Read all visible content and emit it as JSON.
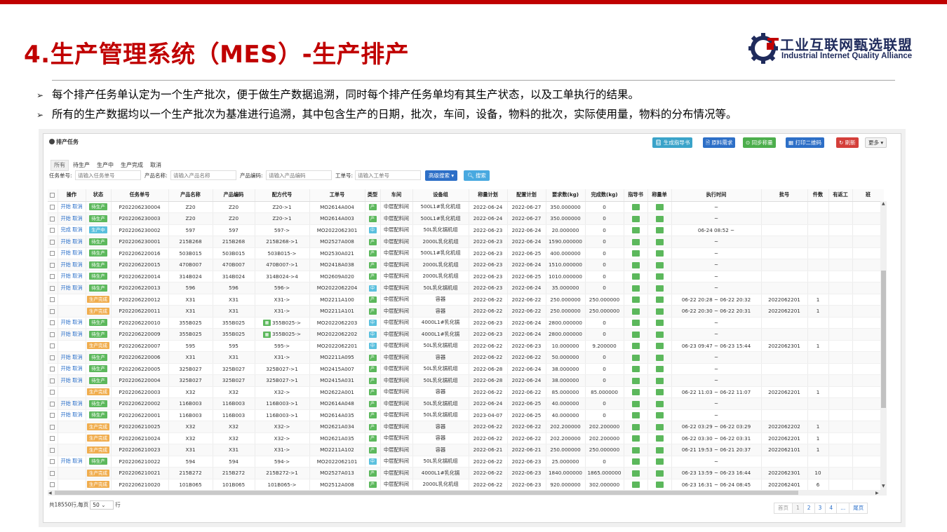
{
  "slide": {
    "title": "4.生产管理系统（MES）-生产排产",
    "logo_cn": "工业互联网甄选联盟",
    "logo_en": "Industrial Internet Quality Alliance",
    "bullets": [
      "每个排产任务单认定为一个生产批次，便于做生产数据追溯，同时每个排产任务单均有其生产状态，以及工单执行的结果。",
      "所有的生产数据均以一个生产批次为基准进行追溯，其中包含生产的日期，批次，车间，设备，物料的批次，实际使用量，物料的分布情况等。"
    ],
    "bullet_marker": "➢"
  },
  "app": {
    "title": "排产任务",
    "toolbar": [
      {
        "label": "生成指导书",
        "color": "#3aa3c9"
      },
      {
        "label": "原料需求",
        "color": "#2d6fc7"
      },
      {
        "label": "同步称量",
        "color": "#4cae4c"
      },
      {
        "label": "打印二维码",
        "color": "#2d6fc7"
      },
      {
        "label": "刷新",
        "color": "#d43f3a"
      },
      {
        "label": "更多",
        "color": "#f2f2f2"
      }
    ],
    "tabs": [
      "所有",
      "待生产",
      "生产中",
      "生产完成",
      "取消"
    ],
    "filters": {
      "task_label": "任务单号:",
      "task_placeholder": "请输入任务单号",
      "product_name_label": "产品名称:",
      "product_name_placeholder": "请输入产品名称",
      "product_code_label": "产品编码:",
      "product_code_placeholder": "请输入产品编码",
      "work_order_label": "工单号:",
      "work_order_placeholder": "请输入工单号"
    },
    "advanced_search": "高级搜索",
    "search": "搜索",
    "columns": [
      "操作",
      "状态",
      "任务单号",
      "产品名称",
      "产品编码",
      "配方代号",
      "工单号",
      "类型",
      "车间",
      "设备组",
      "称量计划",
      "配置计划",
      "要求数(kg)",
      "完成数(kg)",
      "指导书",
      "称量单",
      "执行时间",
      "批号",
      "件数",
      "有返工",
      "班"
    ],
    "rows": [
      {
        "ops": "开始 取消",
        "status": "待生产",
        "st": "s1",
        "task": "P202206230004",
        "name": "Z20",
        "code": "Z20",
        "formula": "Z20->1",
        "fm": false,
        "wo": "MO2614A004",
        "type": "产",
        "tc": "g",
        "ws": "中层配料间",
        "eq": "500L1#乳化机组",
        "wp": "2022-06-24",
        "cp": "2022-06-27",
        "req": "350.000000",
        "done": "0",
        "time": "~",
        "batch": "",
        "qty": ""
      },
      {
        "ops": "开始 取消",
        "status": "待生产",
        "st": "s1",
        "task": "P202206230003",
        "name": "Z20",
        "code": "Z20",
        "formula": "Z20->1",
        "fm": false,
        "wo": "MO2614A003",
        "type": "产",
        "tc": "g",
        "ws": "中层配料间",
        "eq": "500L1#乳化机组",
        "wp": "2022-06-24",
        "cp": "2022-06-27",
        "req": "350.000000",
        "done": "0",
        "time": "~",
        "batch": "",
        "qty": ""
      },
      {
        "ops": "完成 取消",
        "status": "生产中",
        "st": "s2",
        "task": "P202206230002",
        "name": "597",
        "code": "597",
        "formula": "597->",
        "fm": false,
        "wo": "MO2022062301",
        "type": "中",
        "tc": "b",
        "ws": "中层配料间",
        "eq": "50L乳化锅机组",
        "wp": "2022-06-23",
        "cp": "2022-06-24",
        "req": "20.000000",
        "done": "0",
        "time": "06-24 08:52 ~",
        "batch": "",
        "qty": ""
      },
      {
        "ops": "开始 取消",
        "status": "待生产",
        "st": "s1",
        "task": "P202206230001",
        "name": "215B268",
        "code": "215B268",
        "formula": "215B268->1",
        "fm": false,
        "wo": "MO2527A008",
        "type": "产",
        "tc": "g",
        "ws": "中层配料间",
        "eq": "2000L乳化机组",
        "wp": "2022-06-23",
        "cp": "2022-06-24",
        "req": "1590.000000",
        "done": "0",
        "time": "~",
        "batch": "",
        "qty": ""
      },
      {
        "ops": "开始 取消",
        "status": "待生产",
        "st": "s1",
        "task": "P202206220016",
        "name": "503B015",
        "code": "503B015",
        "formula": "503B015->",
        "fm": false,
        "wo": "MO2530A021",
        "type": "产",
        "tc": "g",
        "ws": "中层配料间",
        "eq": "500L1#乳化机组",
        "wp": "2022-06-23",
        "cp": "2022-06-25",
        "req": "400.000000",
        "done": "0",
        "time": "~",
        "batch": "",
        "qty": ""
      },
      {
        "ops": "开始 取消",
        "status": "待生产",
        "st": "s1",
        "task": "P202206220015",
        "name": "470B007",
        "code": "470B007",
        "formula": "470B007->1",
        "fm": false,
        "wo": "MO2418A038",
        "type": "产",
        "tc": "g",
        "ws": "中层配料间",
        "eq": "2000L乳化机组",
        "wp": "2022-06-23",
        "cp": "2022-06-24",
        "req": "1510.000000",
        "done": "0",
        "time": "~",
        "batch": "",
        "qty": ""
      },
      {
        "ops": "开始 取消",
        "status": "待生产",
        "st": "s1",
        "task": "P202206220014",
        "name": "314B024",
        "code": "314B024",
        "formula": "314B024->4",
        "fm": false,
        "wo": "MO2609A020",
        "type": "产",
        "tc": "g",
        "ws": "中层配料间",
        "eq": "2000L乳化机组",
        "wp": "2022-06-23",
        "cp": "2022-06-25",
        "req": "1010.000000",
        "done": "0",
        "time": "~",
        "batch": "",
        "qty": ""
      },
      {
        "ops": "开始 取消",
        "status": "待生产",
        "st": "s1",
        "task": "P202206220013",
        "name": "596",
        "code": "596",
        "formula": "596->",
        "fm": false,
        "wo": "MO2022062204",
        "type": "中",
        "tc": "b",
        "ws": "中层配料间",
        "eq": "50L乳化锅机组",
        "wp": "2022-06-23",
        "cp": "2022-06-24",
        "req": "35.000000",
        "done": "0",
        "time": "~",
        "batch": "",
        "qty": ""
      },
      {
        "ops": "",
        "status": "生产完成",
        "st": "s3",
        "task": "P202206220012",
        "name": "X31",
        "code": "X31",
        "formula": "X31->",
        "fm": false,
        "wo": "MO2211A100",
        "type": "产",
        "tc": "g",
        "ws": "中层配料间",
        "eq": "容器",
        "wp": "2022-06-22",
        "cp": "2022-06-22",
        "req": "250.000000",
        "done": "250.000000",
        "time": "06-22 20:28 ~ 06-22 20:32",
        "batch": "2022062201",
        "qty": "1"
      },
      {
        "ops": "",
        "status": "生产完成",
        "st": "s3",
        "task": "P202206220011",
        "name": "X31",
        "code": "X31",
        "formula": "X31->",
        "fm": false,
        "wo": "MO2211A101",
        "type": "产",
        "tc": "g",
        "ws": "中层配料间",
        "eq": "容器",
        "wp": "2022-06-22",
        "cp": "2022-06-22",
        "req": "250.000000",
        "done": "250.000000",
        "time": "06-22 20:30 ~ 06-22 20:31",
        "batch": "2022062201",
        "qty": "1"
      },
      {
        "ops": "开始 取消",
        "status": "待生产",
        "st": "s1",
        "task": "P202206220010",
        "name": "355B025",
        "code": "355B025",
        "formula": "355B025->",
        "fm": true,
        "wo": "MO2022062203",
        "type": "中",
        "tc": "b",
        "ws": "中层配料间",
        "eq": "4000L1#乳化锅",
        "wp": "2022-06-23",
        "cp": "2022-06-24",
        "req": "2800.000000",
        "done": "0",
        "time": "~",
        "batch": "",
        "qty": ""
      },
      {
        "ops": "开始 取消",
        "status": "待生产",
        "st": "s1",
        "task": "P202206220009",
        "name": "355B025",
        "code": "355B025",
        "formula": "355B025->",
        "fm": true,
        "wo": "MO2022062202",
        "type": "中",
        "tc": "b",
        "ws": "中层配料间",
        "eq": "4000L1#乳化锅",
        "wp": "2022-06-23",
        "cp": "2022-06-24",
        "req": "2800.000000",
        "done": "0",
        "time": "~",
        "batch": "",
        "qty": ""
      },
      {
        "ops": "",
        "status": "生产完成",
        "st": "s3",
        "task": "P202206220007",
        "name": "595",
        "code": "595",
        "formula": "595->",
        "fm": false,
        "wo": "MO2022062201",
        "type": "中",
        "tc": "b",
        "ws": "中层配料间",
        "eq": "50L乳化锅机组",
        "wp": "2022-06-22",
        "cp": "2022-06-23",
        "req": "10.000000",
        "done": "9.200000",
        "time": "06-23 09:47 ~ 06-23 15:44",
        "batch": "2022062301",
        "qty": "1"
      },
      {
        "ops": "开始 取消",
        "status": "待生产",
        "st": "s1",
        "task": "P202206220006",
        "name": "X31",
        "code": "X31",
        "formula": "X31->",
        "fm": false,
        "wo": "MO2211A095",
        "type": "产",
        "tc": "g",
        "ws": "中层配料间",
        "eq": "容器",
        "wp": "2022-06-22",
        "cp": "2022-06-22",
        "req": "50.000000",
        "done": "0",
        "time": "~",
        "batch": "",
        "qty": ""
      },
      {
        "ops": "开始 取消",
        "status": "待生产",
        "st": "s1",
        "task": "P202206220005",
        "name": "325B027",
        "code": "325B027",
        "formula": "325B027->1",
        "fm": false,
        "wo": "MO2415A007",
        "type": "产",
        "tc": "g",
        "ws": "中层配料间",
        "eq": "50L乳化锅机组",
        "wp": "2022-06-28",
        "cp": "2022-06-24",
        "req": "38.000000",
        "done": "0",
        "time": "~",
        "batch": "",
        "qty": ""
      },
      {
        "ops": "开始 取消",
        "status": "待生产",
        "st": "s1",
        "task": "P202206220004",
        "name": "325B027",
        "code": "325B027",
        "formula": "325B027->1",
        "fm": false,
        "wo": "MO2415A031",
        "type": "产",
        "tc": "g",
        "ws": "中层配料间",
        "eq": "50L乳化锅机组",
        "wp": "2022-06-28",
        "cp": "2022-06-24",
        "req": "38.000000",
        "done": "0",
        "time": "~",
        "batch": "",
        "qty": ""
      },
      {
        "ops": "",
        "status": "生产完成",
        "st": "s3",
        "task": "P202206220003",
        "name": "X32",
        "code": "X32",
        "formula": "X32->",
        "fm": false,
        "wo": "MO2622A001",
        "type": "产",
        "tc": "g",
        "ws": "中层配料间",
        "eq": "容器",
        "wp": "2022-06-22",
        "cp": "2022-06-22",
        "req": "85.000000",
        "done": "85.000000",
        "time": "06-22 11:03 ~ 06-22 11:07",
        "batch": "2022062201",
        "qty": "1"
      },
      {
        "ops": "开始 取消",
        "status": "待生产",
        "st": "s1",
        "task": "P202206220002",
        "name": "116B003",
        "code": "116B003",
        "formula": "116B003->1",
        "fm": false,
        "wo": "MO2614A048",
        "type": "产",
        "tc": "g",
        "ws": "中层配料间",
        "eq": "50L乳化锅机组",
        "wp": "2022-06-24",
        "cp": "2022-06-25",
        "req": "40.000000",
        "done": "0",
        "time": "~",
        "batch": "",
        "qty": ""
      },
      {
        "ops": "开始 取消",
        "status": "待生产",
        "st": "s1",
        "task": "P202206220001",
        "name": "116B003",
        "code": "116B003",
        "formula": "116B003->1",
        "fm": false,
        "wo": "MO2614A035",
        "type": "产",
        "tc": "g",
        "ws": "中层配料间",
        "eq": "50L乳化锅机组",
        "wp": "2023-04-07",
        "cp": "2022-06-25",
        "req": "40.000000",
        "done": "0",
        "time": "~",
        "batch": "",
        "qty": ""
      },
      {
        "ops": "",
        "status": "生产完成",
        "st": "s3",
        "task": "P202206210025",
        "name": "X32",
        "code": "X32",
        "formula": "X32->",
        "fm": false,
        "wo": "MO2621A034",
        "type": "产",
        "tc": "g",
        "ws": "中层配料间",
        "eq": "容器",
        "wp": "2022-06-22",
        "cp": "2022-06-22",
        "req": "202.200000",
        "done": "202.200000",
        "time": "06-22 03:29 ~ 06-22 03:29",
        "batch": "2022062202",
        "qty": "1"
      },
      {
        "ops": "",
        "status": "生产完成",
        "st": "s3",
        "task": "P202206210024",
        "name": "X32",
        "code": "X32",
        "formula": "X32->",
        "fm": false,
        "wo": "MO2621A035",
        "type": "产",
        "tc": "g",
        "ws": "中层配料间",
        "eq": "容器",
        "wp": "2022-06-22",
        "cp": "2022-06-22",
        "req": "202.200000",
        "done": "202.200000",
        "time": "06-22 03:30 ~ 06-22 03:31",
        "batch": "2022062201",
        "qty": "1"
      },
      {
        "ops": "",
        "status": "生产完成",
        "st": "s3",
        "task": "P202206210023",
        "name": "X31",
        "code": "X31",
        "formula": "X31->",
        "fm": false,
        "wo": "MO2211A102",
        "type": "产",
        "tc": "g",
        "ws": "中层配料间",
        "eq": "容器",
        "wp": "2022-06-21",
        "cp": "2022-06-21",
        "req": "250.000000",
        "done": "250.000000",
        "time": "06-21 19:53 ~ 06-21 20:37",
        "batch": "2022062101",
        "qty": "1"
      },
      {
        "ops": "开始 取消",
        "status": "待生产",
        "st": "s1",
        "task": "P202206210022",
        "name": "594",
        "code": "594",
        "formula": "594->",
        "fm": false,
        "wo": "MO2022062101",
        "type": "中",
        "tc": "b",
        "ws": "中层配料间",
        "eq": "50L乳化锅机组",
        "wp": "2022-06-22",
        "cp": "2022-06-23",
        "req": "25.000000",
        "done": "0",
        "time": "~",
        "batch": "",
        "qty": ""
      },
      {
        "ops": "",
        "status": "生产完成",
        "st": "s3",
        "task": "P202206210021",
        "name": "215B272",
        "code": "215B272",
        "formula": "215B272->1",
        "fm": false,
        "wo": "MO2527A013",
        "type": "产",
        "tc": "g",
        "ws": "中层配料间",
        "eq": "4000L1#乳化锅",
        "wp": "2022-06-22",
        "cp": "2022-06-23",
        "req": "1840.000000",
        "done": "1865.000000",
        "time": "06-23 13:59 ~ 06-23 16:44",
        "batch": "2022062301",
        "qty": "10"
      },
      {
        "ops": "",
        "status": "生产完成",
        "st": "s3",
        "task": "P202206210020",
        "name": "101B065",
        "code": "101B065",
        "formula": "101B065->",
        "fm": false,
        "wo": "MO2512A008",
        "type": "产",
        "tc": "g",
        "ws": "中层配料间",
        "eq": "2000L乳化机组",
        "wp": "2022-06-22",
        "cp": "2022-06-23",
        "req": "920.000000",
        "done": "302.000000",
        "time": "06-23 16:31 ~ 06-24 08:45",
        "batch": "2022062401",
        "qty": "6"
      }
    ],
    "footer": {
      "total": "共18550行,每页",
      "page_size": "50",
      "suffix": "行"
    },
    "pager": [
      "首页",
      "1",
      "2",
      "3",
      "4",
      "...",
      "尾页"
    ]
  }
}
